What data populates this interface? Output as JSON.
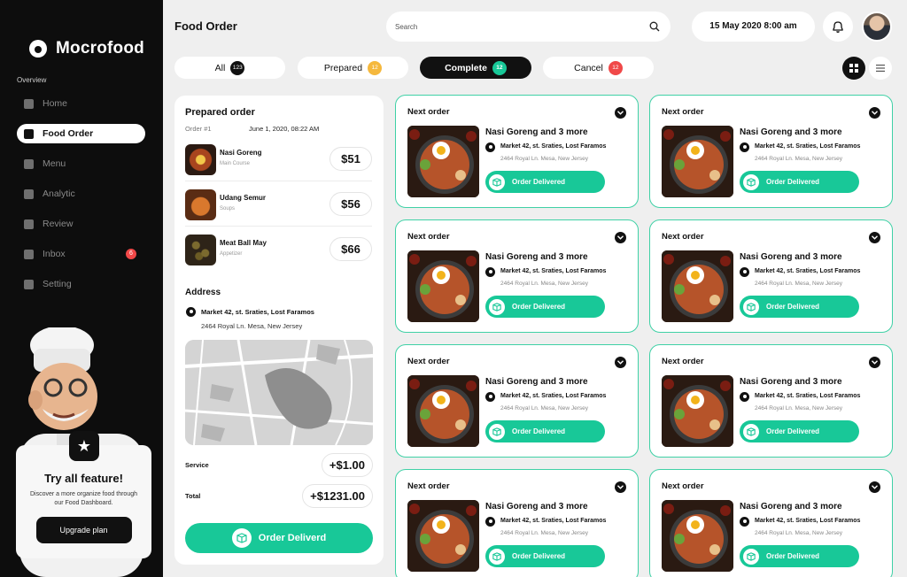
{
  "app": {
    "name": "Mocrofood"
  },
  "sidebar": {
    "section_label": "Overview",
    "items": [
      {
        "label": "Home",
        "icon": "home-icon"
      },
      {
        "label": "Food Order",
        "icon": "clipboard-icon",
        "active": true
      },
      {
        "label": "Menu",
        "icon": "menu-icon"
      },
      {
        "label": "Analytic",
        "icon": "chart-icon"
      },
      {
        "label": "Review",
        "icon": "review-icon"
      },
      {
        "label": "Inbox",
        "icon": "inbox-icon",
        "badge": "6"
      },
      {
        "label": "Setting",
        "icon": "gear-icon"
      }
    ],
    "promo": {
      "title": "Try all feature!",
      "text": "Discover a more organize food through our Food Dashboard.",
      "button": "Upgrade plan"
    }
  },
  "header": {
    "title": "Food Order",
    "search_placeholder": "Search",
    "date": "15 May 2020 8:00 am"
  },
  "tabs": [
    {
      "label": "All",
      "count": "123",
      "color": "#111111"
    },
    {
      "label": "Prepared",
      "count": "12",
      "color": "#f5b83d"
    },
    {
      "label": "Complete",
      "count": "12",
      "color": "#18c898",
      "active": true
    },
    {
      "label": "Cancel",
      "count": "12",
      "color": "#f04848"
    }
  ],
  "prepared": {
    "title": "Prepared order",
    "order_id": "Order #1",
    "order_date": "June 1, 2020, 08:22 AM",
    "items": [
      {
        "name": "Nasi Goreng",
        "category": "Main Course",
        "price": "$51"
      },
      {
        "name": "Udang Semur",
        "category": "Soups",
        "price": "$56"
      },
      {
        "name": "Meat Ball May",
        "category": "Appetizer",
        "price": "$66"
      }
    ],
    "address_title": "Address",
    "address_line1": "Market 42, st. Sraties, Lost Faramos",
    "address_line2": "2464 Royal Ln. Mesa, New Jersey",
    "service_label": "Service",
    "service_value": "+$1.00",
    "total_label": "Total",
    "total_value": "+$1231.00",
    "button": "Order Deliverd"
  },
  "cards": [
    {
      "title": "Next order",
      "name": "Nasi Goreng and 3 more",
      "address1": "Market 42, st. Sraties, Lost Faramos",
      "address2": "2464 Royal Ln. Mesa, New Jersey",
      "button": "Order Delivered"
    },
    {
      "title": "Next order",
      "name": "Nasi Goreng and 3 more",
      "address1": "Market 42, st. Sraties, Lost Faramos",
      "address2": "2464 Royal Ln. Mesa, New Jersey",
      "button": "Order Delivered"
    },
    {
      "title": "Next order",
      "name": "Nasi Goreng and 3 more",
      "address1": "Market 42, st. Sraties, Lost Faramos",
      "address2": "2464 Royal Ln. Mesa, New Jersey",
      "button": "Order Delivered"
    },
    {
      "title": "Next order",
      "name": "Nasi Goreng and 3 more",
      "address1": "Market 42, st. Sraties, Lost Faramos",
      "address2": "2464 Royal Ln. Mesa, New Jersey",
      "button": "Order Delivered"
    },
    {
      "title": "Next order",
      "name": "Nasi Goreng and 3 more",
      "address1": "Market 42, st. Sraties, Lost Faramos",
      "address2": "2464 Royal Ln. Mesa, New Jersey",
      "button": "Order Delivered"
    },
    {
      "title": "Next order",
      "name": "Nasi Goreng and 3 more",
      "address1": "Market 42, st. Sraties, Lost Faramos",
      "address2": "2464 Royal Ln. Mesa, New Jersey",
      "button": "Order Delivered"
    },
    {
      "title": "Next order",
      "name": "Nasi Goreng and 3 more",
      "address1": "Market 42, st. Sraties, Lost Faramos",
      "address2": "2464 Royal Ln. Mesa, New Jersey",
      "button": "Order Delivered"
    },
    {
      "title": "Next order",
      "name": "Nasi Goreng and 3 more",
      "address1": "Market 42, st. Sraties, Lost Faramos",
      "address2": "2464 Royal Ln. Mesa, New Jersey",
      "button": "Order Delivered"
    }
  ],
  "colors": {
    "accent": "#18c898",
    "dark": "#0d0d0d",
    "background": "#efefef"
  }
}
